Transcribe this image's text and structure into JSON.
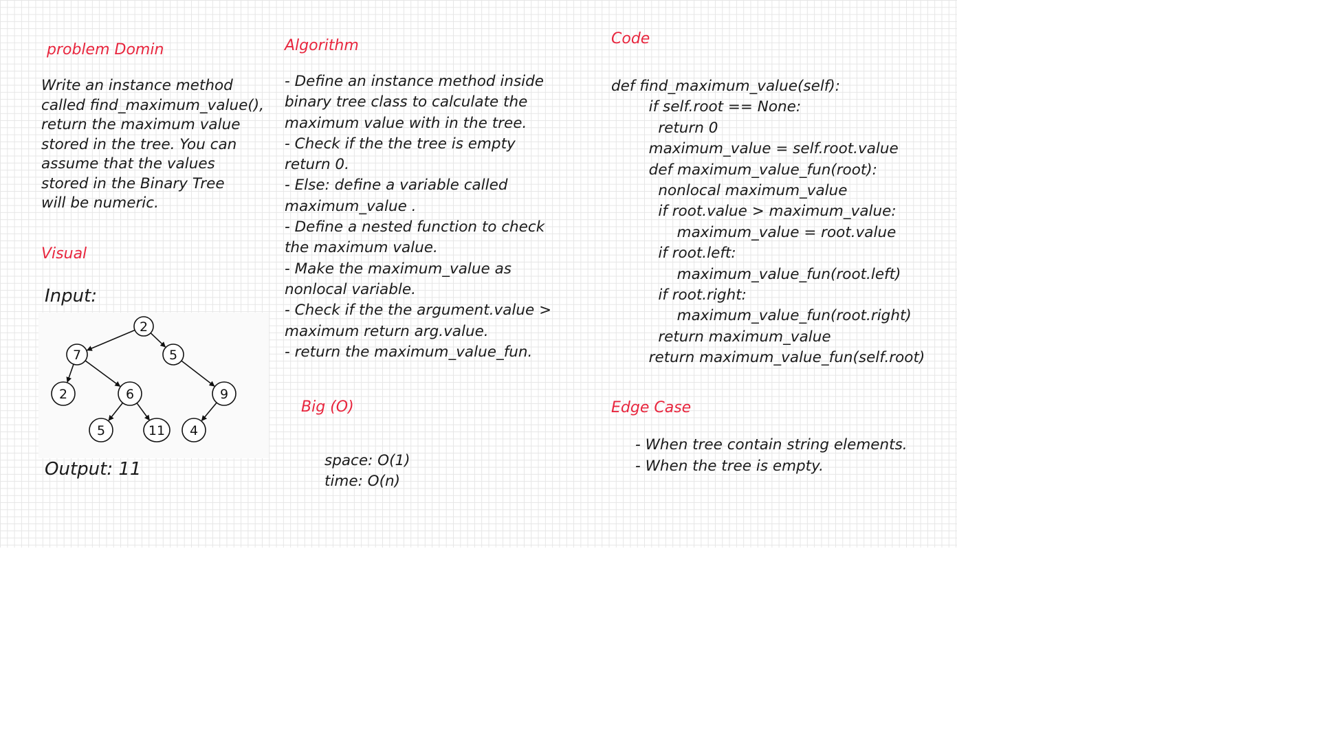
{
  "problem": {
    "heading": "problem Domin",
    "lines": [
      "Write an instance method",
      "called find_maximum_value(),",
      "return the maximum value",
      "stored in the tree. You can",
      "assume that the values",
      "stored in the Binary Tree",
      "will be numeric."
    ]
  },
  "visual": {
    "heading": "Visual",
    "input_label": "Input:",
    "output_label": "Output: 11",
    "tree": {
      "nodes": [
        {
          "id": "n1",
          "value": "2"
        },
        {
          "id": "n2",
          "value": "7"
        },
        {
          "id": "n3",
          "value": "5"
        },
        {
          "id": "n4",
          "value": "2"
        },
        {
          "id": "n5",
          "value": "6"
        },
        {
          "id": "n6",
          "value": "9"
        },
        {
          "id": "n7",
          "value": "5"
        },
        {
          "id": "n8",
          "value": "11"
        },
        {
          "id": "n9",
          "value": "4"
        }
      ],
      "edges": [
        [
          "n1",
          "n2"
        ],
        [
          "n1",
          "n3"
        ],
        [
          "n2",
          "n4"
        ],
        [
          "n2",
          "n5"
        ],
        [
          "n3",
          "n6"
        ],
        [
          "n5",
          "n7"
        ],
        [
          "n5",
          "n8"
        ],
        [
          "n6",
          "n9"
        ]
      ]
    }
  },
  "algorithm": {
    "heading": "Algorithm",
    "lines": [
      "- Define an instance method inside",
      "binary tree class to calculate the",
      "maximum value with in the tree.",
      "- Check if the the tree is empty",
      "return 0.",
      "- Else: define a variable called",
      "maximum_value .",
      "- Define a nested function to check",
      "the maximum value.",
      "- Make the maximum_value as",
      "nonlocal variable.",
      "- Check if the the argument.value >",
      "maximum return arg.value.",
      "- return the maximum_value_fun."
    ]
  },
  "bigo": {
    "heading": "Big (O)",
    "lines": [
      "space: O(1)",
      "time: O(n)"
    ]
  },
  "code": {
    "heading": "Code",
    "lines": [
      "def find_maximum_value(self):",
      "        if self.root == None:",
      "          return 0",
      "        maximum_value = self.root.value",
      "        def maximum_value_fun(root):",
      "          nonlocal maximum_value",
      "          if root.value > maximum_value:",
      "              maximum_value = root.value",
      "          if root.left:",
      "              maximum_value_fun(root.left)",
      "          if root.right:",
      "              maximum_value_fun(root.right)",
      "          return maximum_value",
      "        return maximum_value_fun(self.root)"
    ]
  },
  "edge_case": {
    "heading": "Edge Case",
    "lines": [
      "- When tree contain string elements.",
      "- When the tree is empty."
    ]
  },
  "colors": {
    "heading": "#e8263e",
    "text": "#1a1a1a",
    "grid": "#e6e6e6"
  }
}
